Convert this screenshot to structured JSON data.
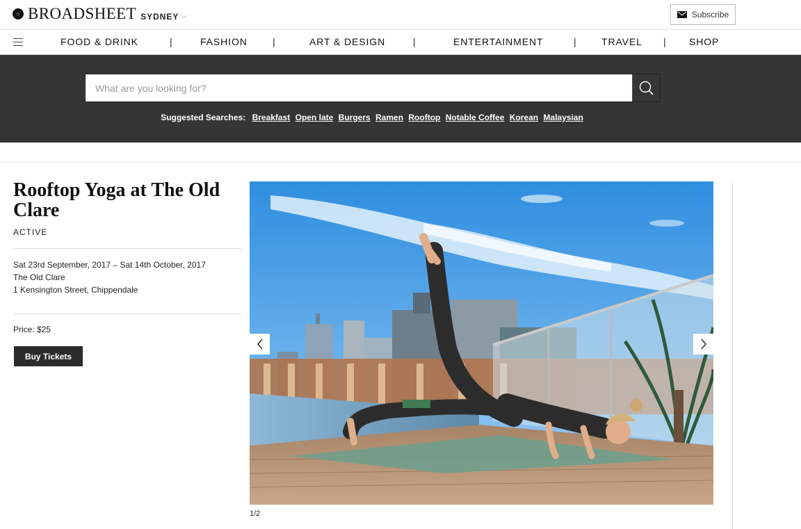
{
  "header": {
    "logo": "BROADSHEET",
    "city": "SYDNEY",
    "subscribe_label": "Subscribe"
  },
  "nav": {
    "items": [
      "FOOD & DRINK",
      "FASHION",
      "ART & DESIGN",
      "ENTERTAINMENT",
      "TRAVEL",
      "SHOP"
    ],
    "separator": "|"
  },
  "search": {
    "placeholder": "What are you looking for?",
    "suggested_label": "Suggested Searches:",
    "suggestions": [
      "Breakfast",
      "Open late",
      "Burgers",
      "Ramen",
      "Rooftop",
      "Notable Coffee",
      "Korean",
      "Malaysian"
    ]
  },
  "event": {
    "title": "Rooftop Yoga at The Old Clare",
    "category": "ACTIVE",
    "dates": "Sat 23rd September, 2017 – Sat 14th October, 2017",
    "venue": "The Old Clare",
    "address": "1 Kensington Street, Chippendale",
    "price": "Price: $25",
    "buy_label": "Buy Tickets"
  },
  "gallery": {
    "counter": "1/2",
    "prev_icon": "chevron-left-icon",
    "next_icon": "chevron-right-icon"
  },
  "colors": {
    "search_band": "#353535",
    "button_dark": "#2b2b2b"
  }
}
